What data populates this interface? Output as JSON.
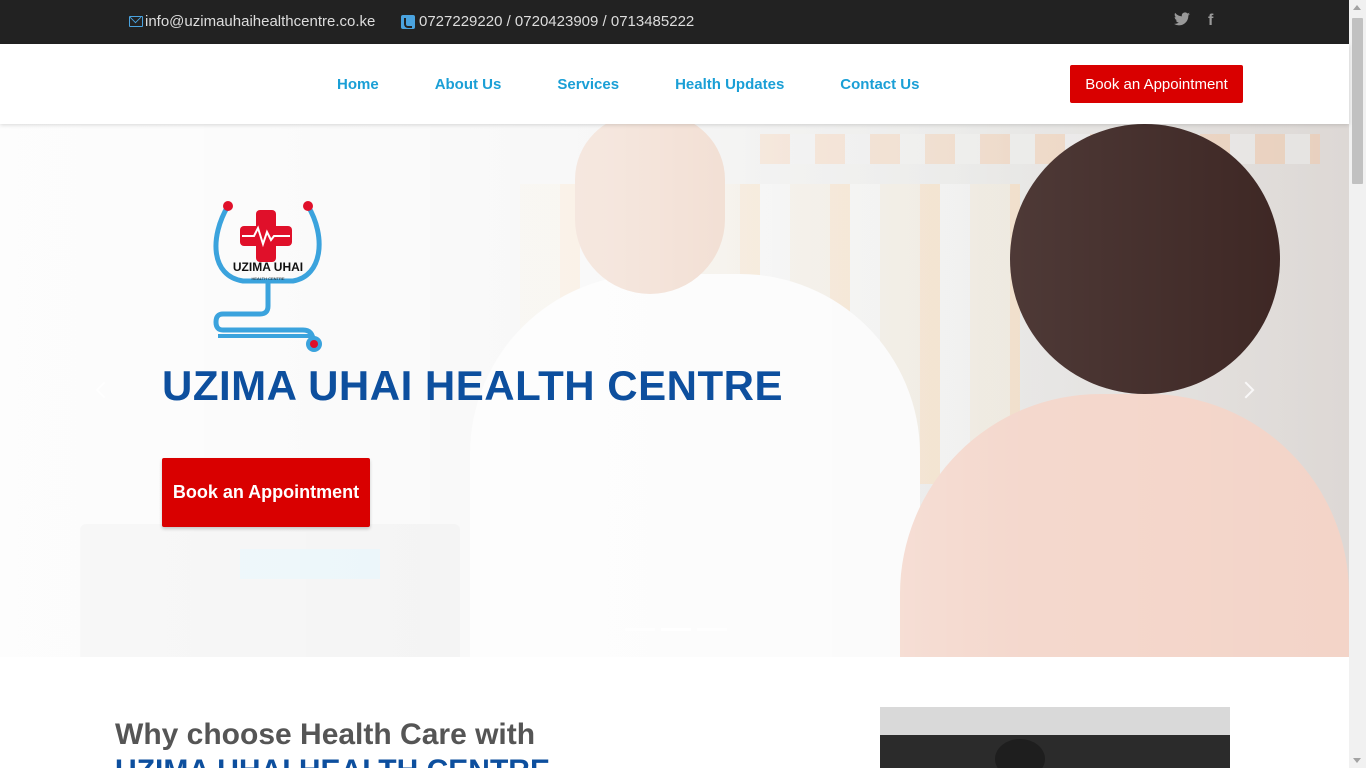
{
  "topbar": {
    "email": "info@uzimauhaihealthcentre.co.ke",
    "phones": "0727229220 / 0720423909 / 0713485222",
    "social": {
      "twitter_glyph": "𝕥",
      "facebook_glyph": "f"
    }
  },
  "nav": {
    "items": [
      {
        "label": "Home"
      },
      {
        "label": "About Us"
      },
      {
        "label": "Services"
      },
      {
        "label": "Health Updates"
      },
      {
        "label": "Contact Us"
      }
    ],
    "cta_label": "Book an Appointment"
  },
  "hero": {
    "logo_text": "UZIMA UHAI",
    "logo_subtext": "HEALTH CENTRE",
    "title": "UZIMA UHAI HEALTH CENTRE",
    "button_label": "Book an Appointment",
    "slides": 3,
    "active_slide": 2
  },
  "why": {
    "heading": "Why choose Health Care with",
    "subheading": "UZIMA UHAI HEALTH CENTRE"
  },
  "colors": {
    "topbar_bg": "#222222",
    "nav_link": "#1a9fd6",
    "cta_red": "#d90000",
    "brand_blue": "#0d4f9e"
  }
}
